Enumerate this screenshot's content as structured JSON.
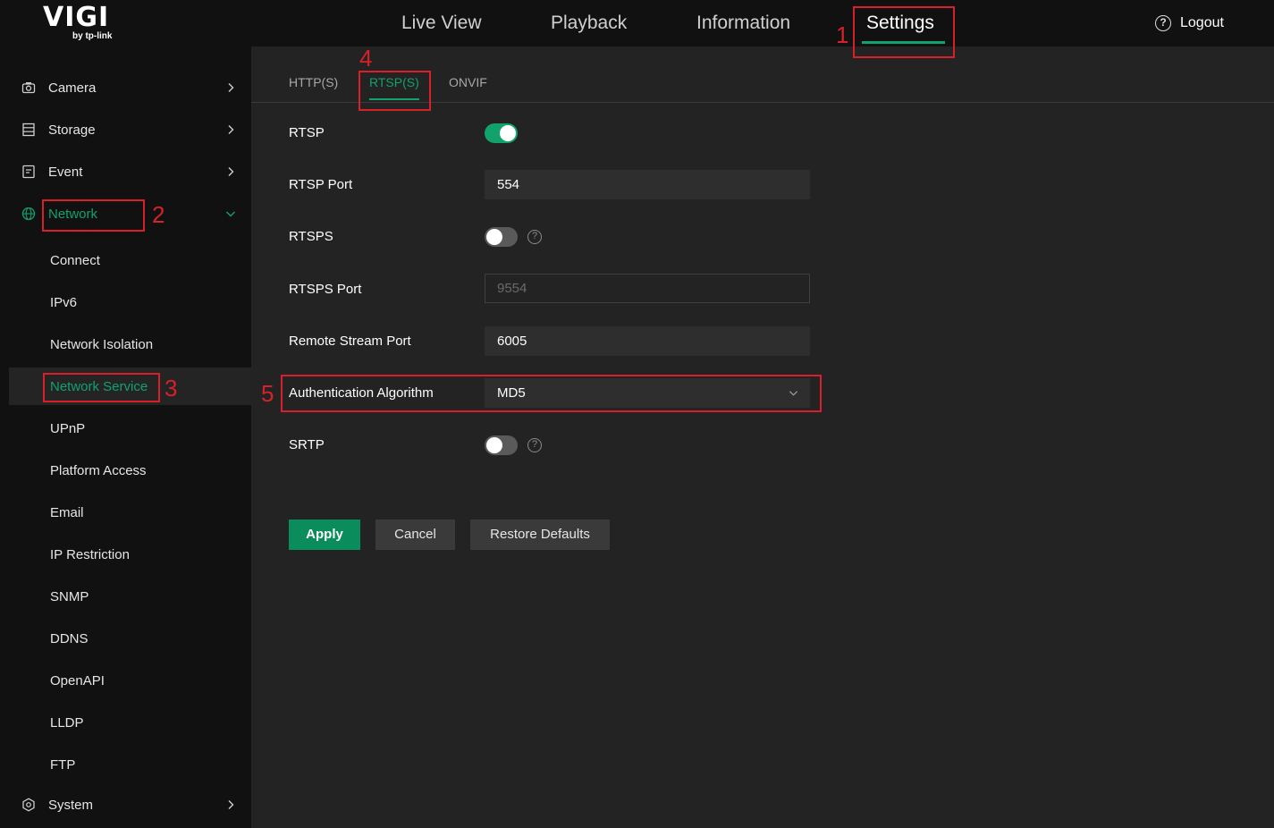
{
  "brand": {
    "name": "VIGI",
    "sub": "by tp-link"
  },
  "topnav": {
    "items": [
      {
        "label": "Live View"
      },
      {
        "label": "Playback"
      },
      {
        "label": "Information"
      },
      {
        "label": "Settings",
        "active": true
      }
    ],
    "logout_label": "Logout"
  },
  "sidebar": {
    "sections": [
      {
        "label": "Camera",
        "icon": "camera-icon"
      },
      {
        "label": "Storage",
        "icon": "storage-icon"
      },
      {
        "label": "Event",
        "icon": "event-icon"
      },
      {
        "label": "Network",
        "icon": "globe-icon",
        "expanded": true
      },
      {
        "label": "System",
        "icon": "system-icon"
      }
    ],
    "network_items": [
      {
        "label": "Connect"
      },
      {
        "label": "IPv6"
      },
      {
        "label": "Network Isolation"
      },
      {
        "label": "Network Service",
        "selected": true
      },
      {
        "label": "UPnP"
      },
      {
        "label": "Platform Access"
      },
      {
        "label": "Email"
      },
      {
        "label": "IP Restriction"
      },
      {
        "label": "SNMP"
      },
      {
        "label": "DDNS"
      },
      {
        "label": "OpenAPI"
      },
      {
        "label": "LLDP"
      },
      {
        "label": "FTP"
      }
    ]
  },
  "tabs": [
    {
      "label": "HTTP(S)"
    },
    {
      "label": "RTSP(S)",
      "active": true
    },
    {
      "label": "ONVIF"
    }
  ],
  "form": {
    "rtsp": {
      "label": "RTSP",
      "enabled": true
    },
    "rtsp_port": {
      "label": "RTSP Port",
      "value": "554"
    },
    "rtsps": {
      "label": "RTSPS",
      "enabled": false
    },
    "rtsps_port": {
      "label": "RTSPS Port",
      "value": "9554",
      "disabled": true
    },
    "remote_stream_port": {
      "label": "Remote Stream Port",
      "value": "6005"
    },
    "auth_algorithm": {
      "label": "Authentication Algorithm",
      "value": "MD5"
    },
    "srtp": {
      "label": "SRTP",
      "enabled": false
    }
  },
  "buttons": {
    "apply": "Apply",
    "cancel": "Cancel",
    "restore": "Restore Defaults"
  },
  "annotations": [
    "1",
    "2",
    "3",
    "4",
    "5"
  ],
  "colors": {
    "accent": "#12a26b",
    "annotation": "#d8202a",
    "panel": "#232323",
    "sidebar": "#111111"
  }
}
